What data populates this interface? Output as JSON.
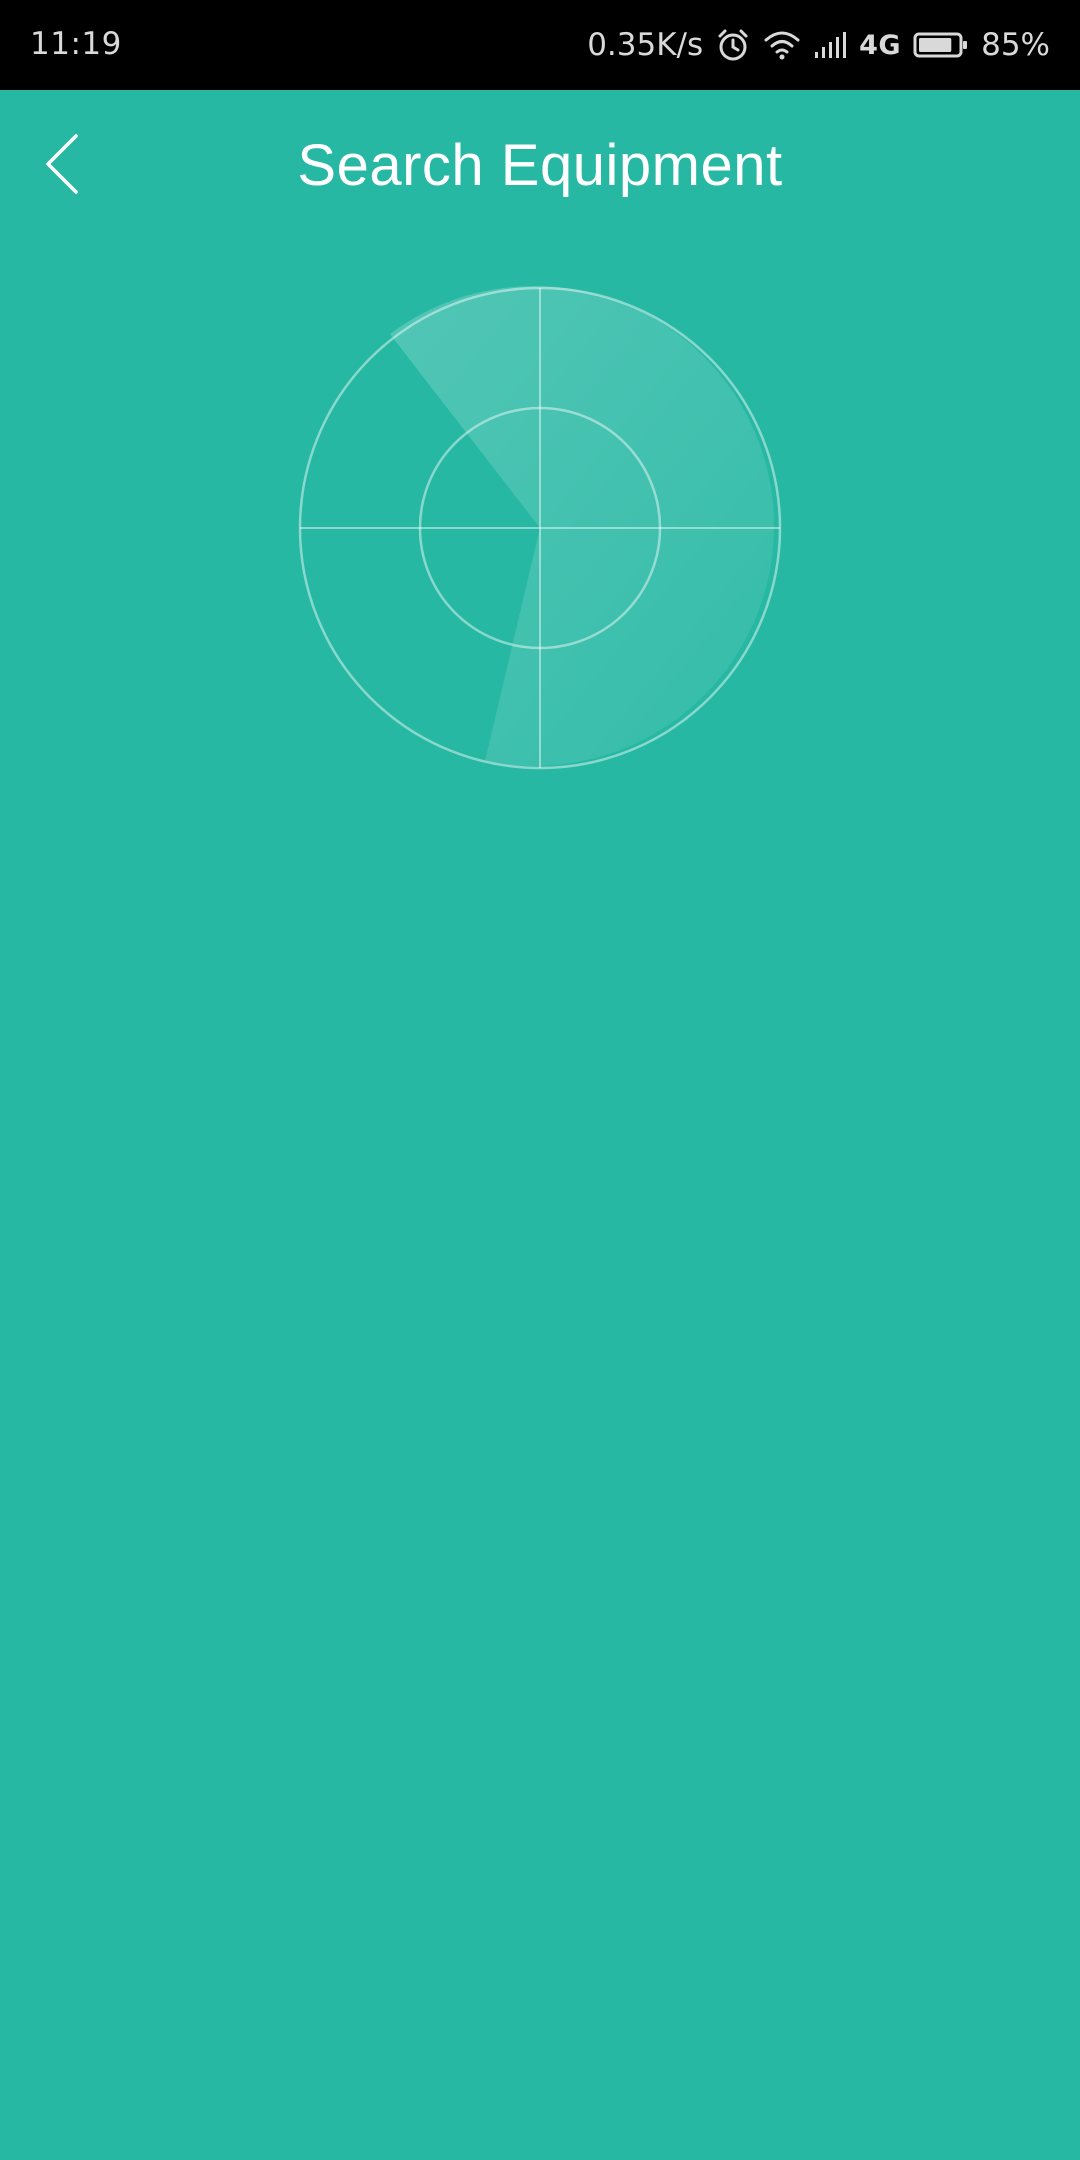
{
  "status_bar": {
    "time": "11:19",
    "network_speed": "0.35K/s",
    "network_type": "4G",
    "battery_percent": "85%",
    "battery_level": 0.85,
    "icons": [
      "alarm-icon",
      "wifi-icon",
      "signal-icon",
      "battery-icon"
    ]
  },
  "header": {
    "back_icon": "chevron-left-icon",
    "title": "Search Equipment"
  },
  "radar": {
    "icon": "radar-icon"
  },
  "colors": {
    "background": "#27b8a4",
    "status_bar": "#000000",
    "text": "#ffffff"
  }
}
